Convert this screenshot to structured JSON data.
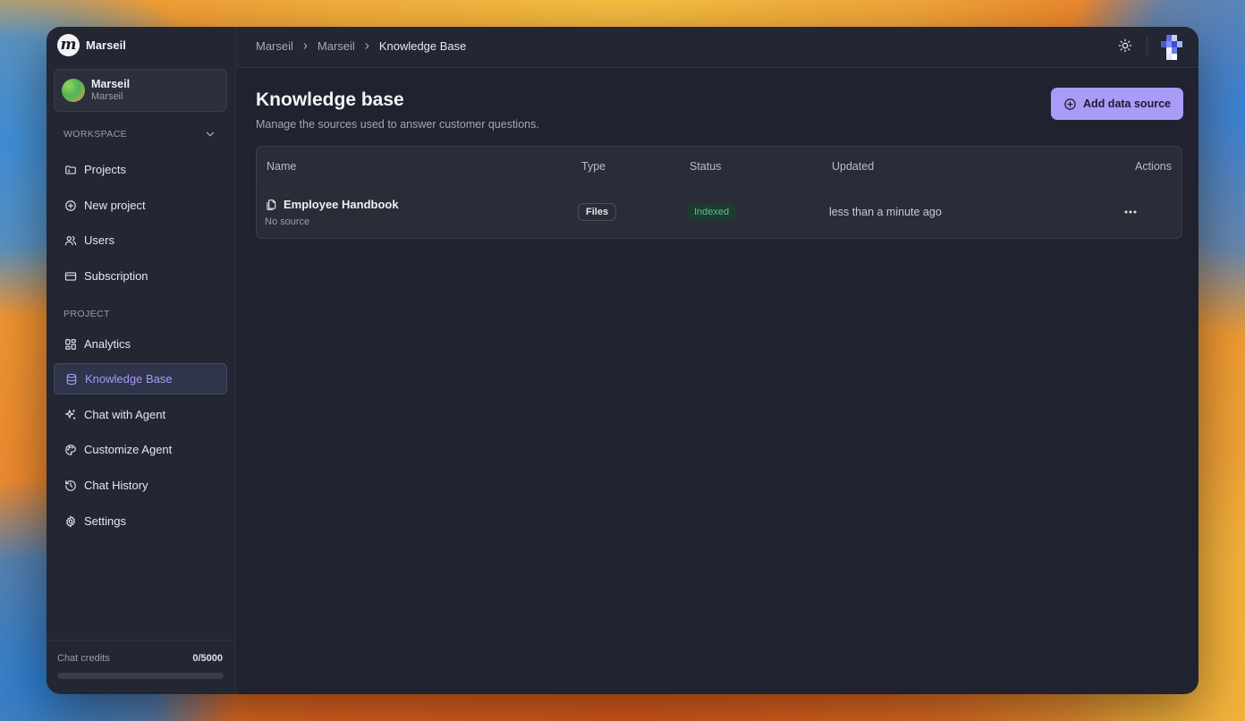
{
  "app": {
    "brand_name": "Marseil",
    "logo_letter": "m"
  },
  "account": {
    "name": "Marseil",
    "subtitle": "Marseil"
  },
  "sidebar": {
    "workspace_label": "WORKSPACE",
    "project_label": "PROJECT",
    "workspace_items": [
      {
        "label": "Projects",
        "icon": "folder-icon"
      },
      {
        "label": "New project",
        "icon": "plus-circle-icon"
      },
      {
        "label": "Users",
        "icon": "users-icon"
      },
      {
        "label": "Subscription",
        "icon": "credit-card-icon"
      }
    ],
    "project_items": [
      {
        "label": "Analytics",
        "icon": "layout-grid-icon"
      },
      {
        "label": "Knowledge Base",
        "icon": "database-icon",
        "active": true
      },
      {
        "label": "Chat with Agent",
        "icon": "sparkles-icon"
      },
      {
        "label": "Customize Agent",
        "icon": "palette-icon"
      },
      {
        "label": "Chat History",
        "icon": "history-icon"
      },
      {
        "label": "Settings",
        "icon": "gear-icon"
      }
    ],
    "credits": {
      "label": "Chat credits",
      "value": "0/5000",
      "used": 0,
      "total": 5000
    }
  },
  "breadcrumb": [
    "Marseil",
    "Marseil",
    "Knowledge Base"
  ],
  "page": {
    "title": "Knowledge base",
    "subtitle": "Manage the sources used to answer customer questions.",
    "add_button_label": "Add data source"
  },
  "table": {
    "columns": [
      "Name",
      "Type",
      "Status",
      "Updated",
      "Actions"
    ],
    "rows": [
      {
        "name": "Employee Handbook",
        "source": "No source",
        "type": "Files",
        "status": "Indexed",
        "updated": "less than a minute ago"
      }
    ]
  },
  "colors": {
    "accent": "#a99cf6",
    "active_text": "#a59af5",
    "status_indexed": "#4fc58a",
    "background": "#20222f"
  }
}
